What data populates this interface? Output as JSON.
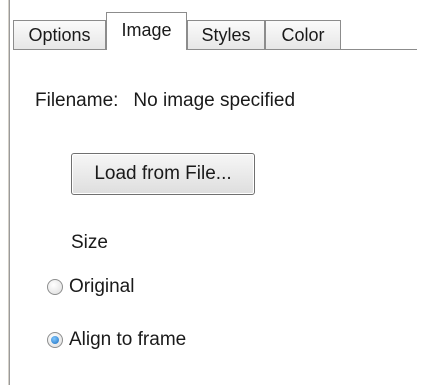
{
  "tabs": [
    {
      "label": "Options",
      "active": false
    },
    {
      "label": "Image",
      "active": true
    },
    {
      "label": "Styles",
      "active": false
    },
    {
      "label": "Color",
      "active": false
    }
  ],
  "image_panel": {
    "filename_label": "Filename:",
    "filename_value": "No image specified",
    "load_button_label": "Load from File...",
    "size_label": "Size",
    "size_options": [
      {
        "label": "Original",
        "checked": false
      },
      {
        "label": "Align to frame",
        "checked": true
      }
    ]
  },
  "colors": {
    "border": "#8c8c8c",
    "radio_selected": "#1e6fbf",
    "background": "#ffffff"
  }
}
